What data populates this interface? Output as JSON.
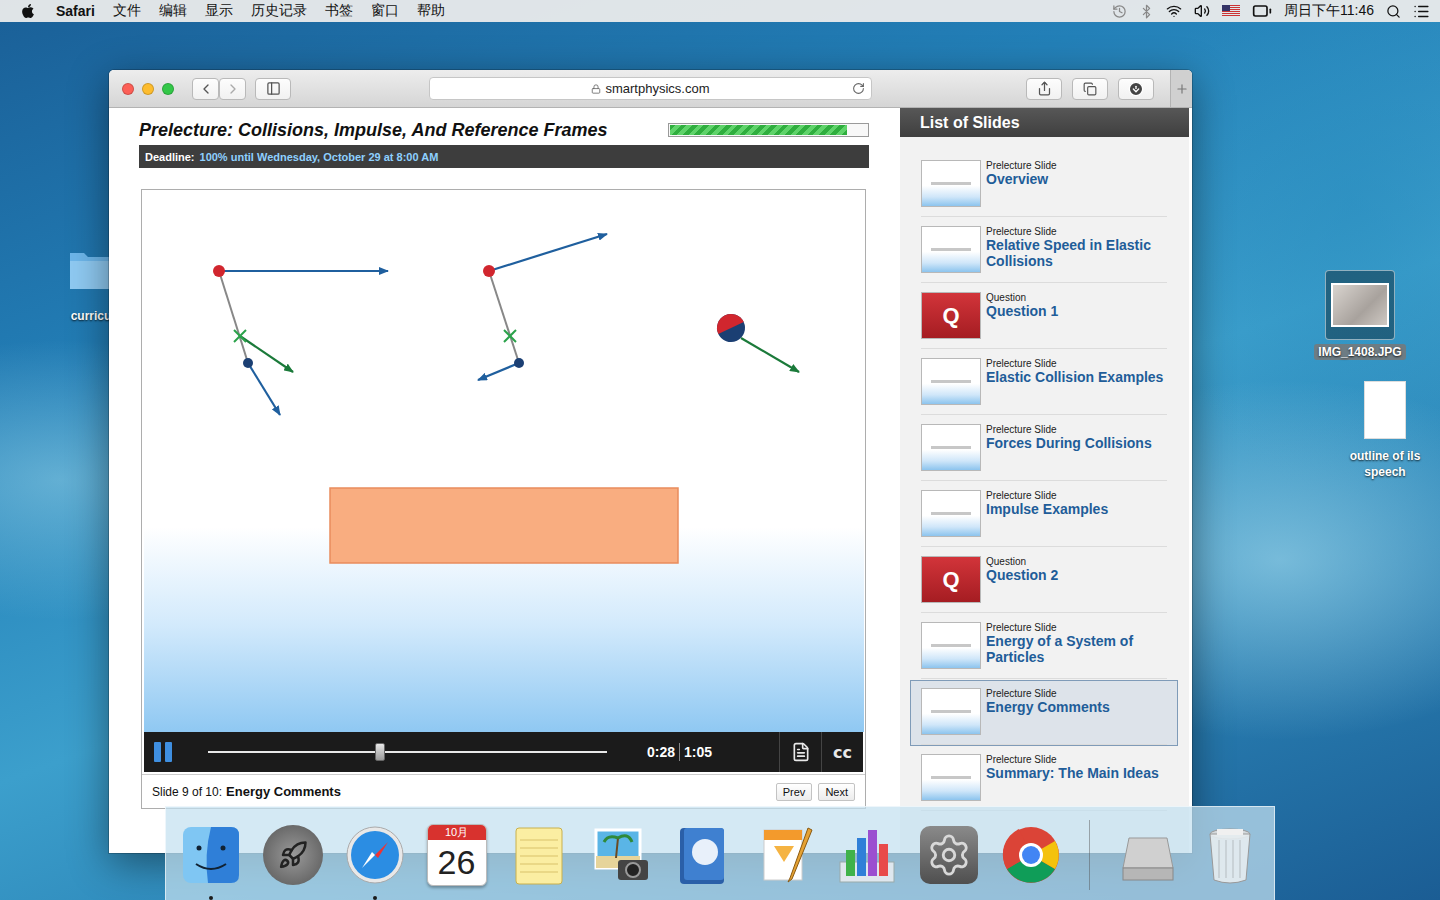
{
  "menu_bar": {
    "app": "Safari",
    "items": [
      "文件",
      "编辑",
      "显示",
      "历史记录",
      "书签",
      "窗口",
      "帮助"
    ],
    "clock": "周日下午11:46"
  },
  "desktop_icons": [
    {
      "label": "curricu",
      "kind": "folder",
      "selected": false
    },
    {
      "label": "IMG_1408.JPG",
      "kind": "image",
      "selected": true
    },
    {
      "label": "outline of ils speech",
      "kind": "document",
      "selected": false
    }
  ],
  "browser": {
    "url": "smartphysics.com"
  },
  "page": {
    "title": "Prelecture: Collisions, Impulse, And Reference Frames",
    "progress": {
      "level": 0.9
    },
    "deadline": {
      "label": "Deadline:",
      "value": "100% until Wednesday, October 29 at 8:00 AM"
    }
  },
  "player": {
    "playing": true,
    "level": 0.43,
    "elapsed": "0:28",
    "duration": "1:05",
    "captions": "cc"
  },
  "footer": {
    "counter": "Slide 9 of 10:",
    "title": "Energy Comments",
    "buttons": [
      "Prev",
      "Next"
    ]
  },
  "slides_panel": {
    "title": "List of Slides",
    "items": [
      {
        "kind": "slide",
        "type": "Prelecture Slide",
        "title": "Overview",
        "selected": false
      },
      {
        "kind": "slide",
        "type": "Prelecture Slide",
        "title": "Relative Speed in Elastic Collisions",
        "selected": false
      },
      {
        "kind": "question",
        "type": "Question",
        "title": "Question 1",
        "icon": "Q",
        "selected": false
      },
      {
        "kind": "slide",
        "type": "Prelecture Slide",
        "title": "Elastic Collision Examples",
        "selected": false
      },
      {
        "kind": "slide",
        "type": "Prelecture Slide",
        "title": "Forces During Collisions",
        "selected": false
      },
      {
        "kind": "slide",
        "type": "Prelecture Slide",
        "title": "Impulse Examples",
        "selected": false
      },
      {
        "kind": "question",
        "type": "Question",
        "title": "Question 2",
        "icon": "Q",
        "selected": false
      },
      {
        "kind": "slide",
        "type": "Prelecture Slide",
        "title": "Energy of a System of Particles",
        "selected": false
      },
      {
        "kind": "slide",
        "type": "Prelecture Slide",
        "title": "Energy Comments",
        "selected": true
      },
      {
        "kind": "slide",
        "type": "Prelecture Slide",
        "title": "Summary: The Main Ideas",
        "selected": false
      }
    ]
  },
  "dock": {
    "apps": [
      {
        "kind": "finder",
        "running": true
      },
      {
        "kind": "launchpad",
        "running": false
      },
      {
        "kind": "safari",
        "running": true
      },
      {
        "kind": "calendar",
        "running": false,
        "month": "10月",
        "day": "26"
      },
      {
        "kind": "notes",
        "running": false
      },
      {
        "kind": "photos",
        "running": false
      },
      {
        "kind": "dictionary",
        "running": false
      },
      {
        "kind": "pages",
        "running": false
      },
      {
        "kind": "numbers",
        "running": false
      },
      {
        "kind": "preferences",
        "running": false
      },
      {
        "kind": "chrome",
        "running": false
      }
    ],
    "stacks": [
      {
        "kind": "drive",
        "running": false
      },
      {
        "kind": "trash",
        "running": false
      }
    ]
  }
}
